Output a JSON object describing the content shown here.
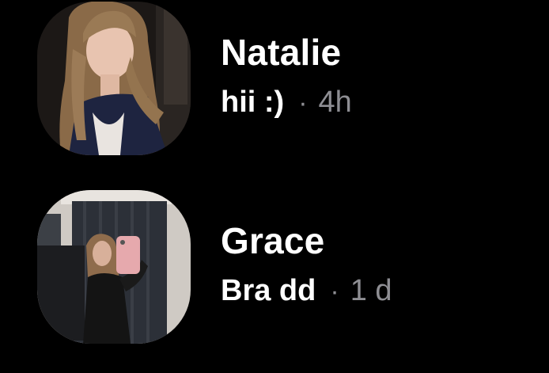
{
  "threads": [
    {
      "name": "Natalie",
      "preview": "hii :)",
      "separator": "·",
      "time": "4h",
      "avatar_icon": "profile-photo-icon"
    },
    {
      "name": "Grace",
      "preview": "Bra dd",
      "separator": "·",
      "time": "1 d",
      "avatar_icon": "profile-photo-icon"
    }
  ],
  "colors": {
    "background": "#000000",
    "name_text": "#ffffff",
    "secondary_text": "#8e8e93"
  }
}
